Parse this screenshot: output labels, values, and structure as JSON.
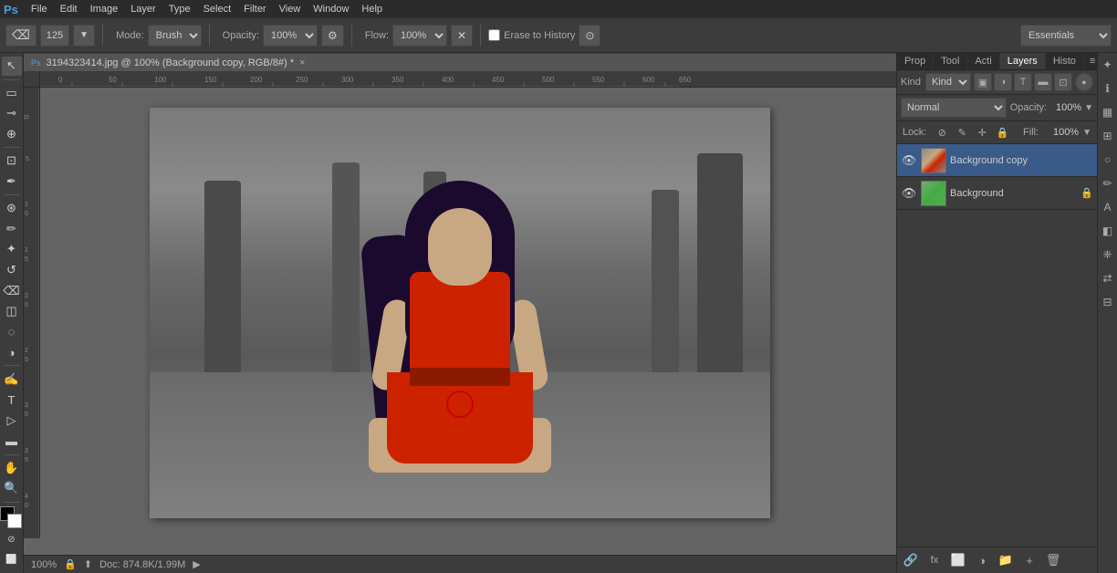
{
  "app": {
    "name": "Adobe Photoshop",
    "logo": "Ps"
  },
  "menu": {
    "items": [
      "File",
      "Edit",
      "Image",
      "Layer",
      "Type",
      "Select",
      "Filter",
      "View",
      "Window",
      "Help"
    ]
  },
  "toolbar": {
    "mode_label": "Mode:",
    "mode_value": "Brush",
    "opacity_label": "Opacity:",
    "opacity_value": "100%",
    "flow_label": "Flow:",
    "flow_value": "100%",
    "erase_to_history": "Erase to History",
    "essentials_label": "Essentials"
  },
  "document": {
    "title": "3194323414.jpg @ 100% (Background copy, RGB/8#) *",
    "zoom": "100%",
    "doc_size": "Doc: 874.8K/1.99M"
  },
  "layers_panel": {
    "tabs": [
      {
        "label": "Prop",
        "active": false
      },
      {
        "label": "Tool",
        "active": false
      },
      {
        "label": "Acti",
        "active": false
      },
      {
        "label": "Layers",
        "active": true
      },
      {
        "label": "Histo",
        "active": false
      }
    ],
    "search_label": "Kind",
    "blend_mode": "Normal",
    "opacity_label": "Opacity:",
    "opacity_value": "100%",
    "fill_label": "Fill:",
    "fill_value": "100%",
    "lock_label": "Lock:",
    "layers": [
      {
        "name": "Background copy",
        "visible": true,
        "selected": true,
        "locked": false,
        "type": "copy"
      },
      {
        "name": "Background",
        "visible": true,
        "selected": false,
        "locked": true,
        "type": "bg"
      }
    ],
    "bottom_buttons": [
      "link",
      "fx",
      "mask",
      "adjustment",
      "group",
      "new",
      "delete"
    ]
  },
  "statusbar": {
    "zoom": "100%",
    "doc_info": "Doc: 874.8K/1.99M"
  }
}
